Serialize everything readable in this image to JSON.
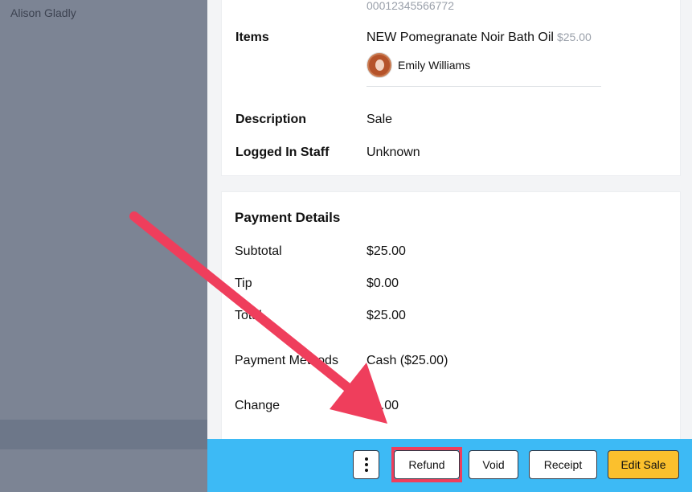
{
  "left": {
    "customer_name": "Alison Gladly"
  },
  "details": {
    "id_value": "00012345566772",
    "items_label": "Items",
    "item_name": "NEW Pomegranate Noir Bath Oil",
    "item_price": "$25.00",
    "staff_name": "Emily Williams",
    "description_label": "Description",
    "description_value": "Sale",
    "logged_in_label": "Logged In Staff",
    "logged_in_value": "Unknown"
  },
  "payment": {
    "title": "Payment Details",
    "subtotal_label": "Subtotal",
    "subtotal_value": "$25.00",
    "tip_label": "Tip",
    "tip_value": "$0.00",
    "total_label": "Total",
    "total_value": "$25.00",
    "methods_label": "Payment Methods",
    "methods_value": "Cash ($25.00)",
    "change_label": "Change",
    "change_value": "$0.00"
  },
  "footer": {
    "refund_label": "Refund",
    "void_label": "Void",
    "receipt_label": "Receipt",
    "edit_label": "Edit Sale"
  },
  "colors": {
    "footer_bg": "#3dbaf5",
    "highlight": "#ef3e5c",
    "edit_button": "#fbc02d",
    "overlay": "#7c8494"
  }
}
